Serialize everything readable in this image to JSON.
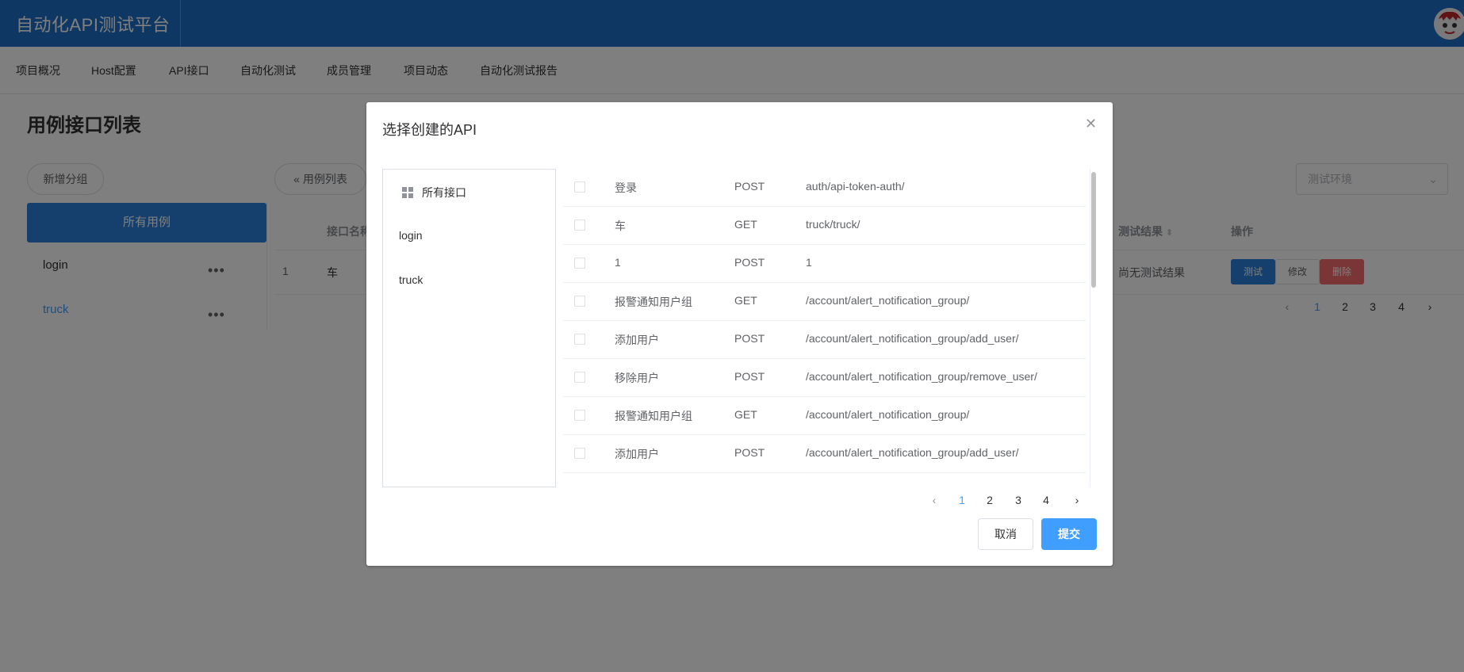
{
  "app": {
    "title": "自动化API测试平台"
  },
  "nav": {
    "items": [
      {
        "label": "项目概况"
      },
      {
        "label": "Host配置"
      },
      {
        "label": "API接口"
      },
      {
        "label": "自动化测试"
      },
      {
        "label": "成员管理"
      },
      {
        "label": "项目动态"
      },
      {
        "label": "自动化测试报告"
      }
    ]
  },
  "page": {
    "title": "用例接口列表",
    "add_group_label": "新增分组",
    "all_cases_label": "所有用例",
    "groups": [
      {
        "label": "login"
      },
      {
        "label": "truck"
      }
    ],
    "case_list_label": "用例列表",
    "env_placeholder": "测试环境",
    "table": {
      "headers": {
        "name": "接口名称",
        "result": "测试结果",
        "ops": "操作"
      },
      "row": {
        "index": "1",
        "name": "车",
        "result": "尚无测试结果"
      },
      "ops": {
        "test": "测试",
        "edit": "修改",
        "delete": "删除"
      }
    },
    "pagination": {
      "pages": [
        "1",
        "2",
        "3",
        "4"
      ],
      "current": "1"
    }
  },
  "dialog": {
    "title": "选择创建的API",
    "tree": {
      "root": "所有接口",
      "items": [
        {
          "label": "login"
        },
        {
          "label": "truck"
        }
      ]
    },
    "rows": [
      {
        "name": "登录",
        "method": "POST",
        "url": "auth/api-token-auth/"
      },
      {
        "name": "车",
        "method": "GET",
        "url": "truck/truck/"
      },
      {
        "name": "1",
        "method": "POST",
        "url": "1"
      },
      {
        "name": "报警通知用户组",
        "method": "GET",
        "url": "/account/alert_notification_group/"
      },
      {
        "name": "添加用户",
        "method": "POST",
        "url": "/account/alert_notification_group/add_user/"
      },
      {
        "name": "移除用户",
        "method": "POST",
        "url": "/account/alert_notification_group/remove_user/"
      },
      {
        "name": "报警通知用户组",
        "method": "GET",
        "url": "/account/alert_notification_group/"
      },
      {
        "name": "添加用户",
        "method": "POST",
        "url": "/account/alert_notification_group/add_user/"
      }
    ],
    "pagination": {
      "pages": [
        "1",
        "2",
        "3",
        "4"
      ],
      "current": "1"
    },
    "cancel_label": "取消",
    "submit_label": "提交"
  },
  "icons": {
    "close": "close-icon",
    "grid": "grid-icon",
    "more": "more-dots-icon",
    "sort": "sort-icon",
    "prev": "chevron-left-icon",
    "next": "chevron-right-icon",
    "back": "double-chevron-left-icon",
    "dropdown": "chevron-down-icon"
  },
  "colors": {
    "primary": "#1f6fc9",
    "accent": "#409eff",
    "danger": "#f56c6c"
  }
}
